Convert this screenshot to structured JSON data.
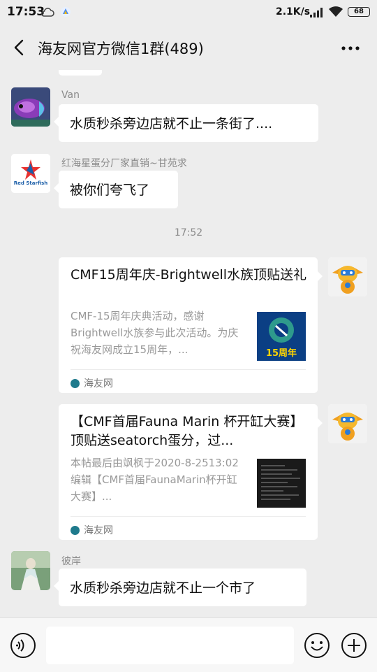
{
  "status_bar": {
    "time": "17:53",
    "network_speed": "2.1K/s",
    "battery_level": "68",
    "icons": [
      "cloud-icon",
      "app-notification-icon",
      "signal-icon",
      "wifi-icon",
      "battery-icon"
    ]
  },
  "header": {
    "title": "海友网官方微信1群(489)",
    "back_icon": "back-chevron-icon",
    "more_icon": "more-dots-icon"
  },
  "messages": [
    {
      "sender": "Van",
      "text": "水质秒杀旁边店就不止一条街了...."
    },
    {
      "sender": "红海星蛋分厂家直销~甘苑求",
      "text": "被你们夸飞了",
      "avatar_logo_text": "Red Starfish"
    },
    {
      "timestamp": "17:52"
    },
    {
      "card_title": "CMF15周年庆-Brightwell水族顶贴送礼",
      "card_desc": "CMF-15周年庆典活动，感谢Brightwell水族参与此次活动。为庆祝海友网成立15周年，...",
      "thumb_text": "15周年",
      "source": "海友网"
    },
    {
      "card_title": "【CMF首届Fauna Marin 杯开缸大赛】顶贴送seatorch蛋分，过...",
      "card_desc": "本帖最后由飒枫于2020-8-2513:02编辑【CMF首届FaunaMarin杯开缸大赛】...",
      "source": "海友网"
    },
    {
      "sender": "彼岸",
      "text": "水质秒杀旁边店就不止一个市了"
    }
  ],
  "input_bar": {
    "placeholder": "",
    "icons": [
      "voice-icon",
      "emoji-icon",
      "plus-icon"
    ]
  },
  "colors": {
    "background": "#ededed",
    "bubble": "#ffffff",
    "secondary_text": "#8a8a8a"
  }
}
